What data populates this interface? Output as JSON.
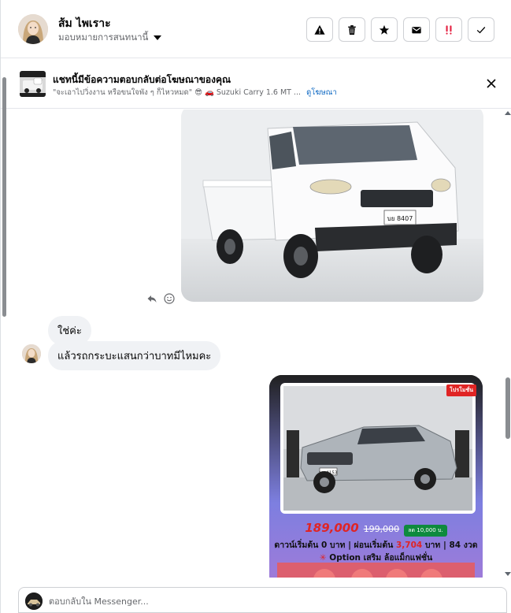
{
  "header": {
    "contact_name": "ส้ม ไพเราะ",
    "assign_label": "มอบหมายการสนทนานี้",
    "actions": [
      {
        "icon": "warning-icon"
      },
      {
        "icon": "trash-icon"
      },
      {
        "icon": "star-icon"
      },
      {
        "icon": "mail-icon"
      },
      {
        "icon": "double-exclamation-icon"
      },
      {
        "icon": "checkmark-icon"
      }
    ]
  },
  "banner": {
    "title": "แชทนี้มีข้อความตอบกลับต่อโฆษณาของคุณ",
    "subtitle": "\"จะเอาไปวิ่งงาน หรือขนใจพัง ๆ ก็ไหวหมด\" 😎 🚗 Suzuki Carry 1.6 MT ...",
    "link": "ดูโฆษณา"
  },
  "messages": [
    {
      "type": "image",
      "from": "contact",
      "description": "white pickup truck photo"
    },
    {
      "type": "text",
      "from": "contact",
      "text": "ใช่ค่ะ"
    },
    {
      "type": "text",
      "from": "contact",
      "text": "แล้วรถกระบะแสนกว่าบาทมีไหมคะ"
    },
    {
      "type": "image",
      "from": "page",
      "description": "promo image silver pickup"
    }
  ],
  "truck_plate": "บย 8407",
  "promo": {
    "tag": "โปรโมชั่น",
    "plate": "บห 4153",
    "price": "189,000",
    "old_price": "199,000",
    "badge": "ลด 10,000 บ.",
    "line1_prefix": "ดาวน์เริ่มต้น 0 บาท | ผ่อนเริ่มต้น",
    "line1_highlight": "3,704",
    "line1_suffix": "บาท | 84 งวด",
    "line2_star": "✳",
    "line2_text": "Option เสริม ล้อแม็กแฟชั่น"
  },
  "composer": {
    "placeholder": "ตอบกลับใน Messenger..."
  },
  "colors": {
    "accent": "#0a66c2",
    "danger": "#e41e3f",
    "bubble": "#f0f2f5"
  }
}
